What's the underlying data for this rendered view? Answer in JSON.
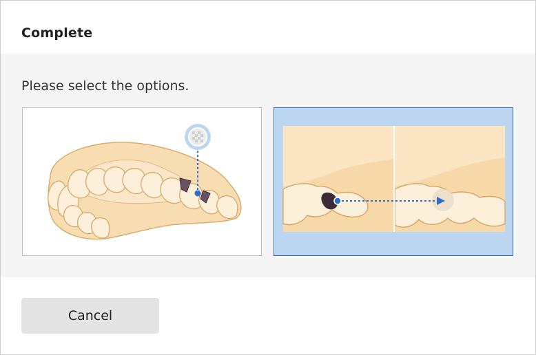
{
  "dialog": {
    "title": "Complete",
    "prompt": "Please select the options.",
    "options": [
      {
        "name": "teeth-arch-option",
        "selected": false
      },
      {
        "name": "tooth-side-view-option",
        "selected": true
      }
    ],
    "cancel_label": "Cancel"
  },
  "colors": {
    "selected_background": "#bcd6f2",
    "selected_border": "#2d6fc4",
    "tooth_fill": "#fbe5c2",
    "accent_blue": "#2d6fc4"
  }
}
